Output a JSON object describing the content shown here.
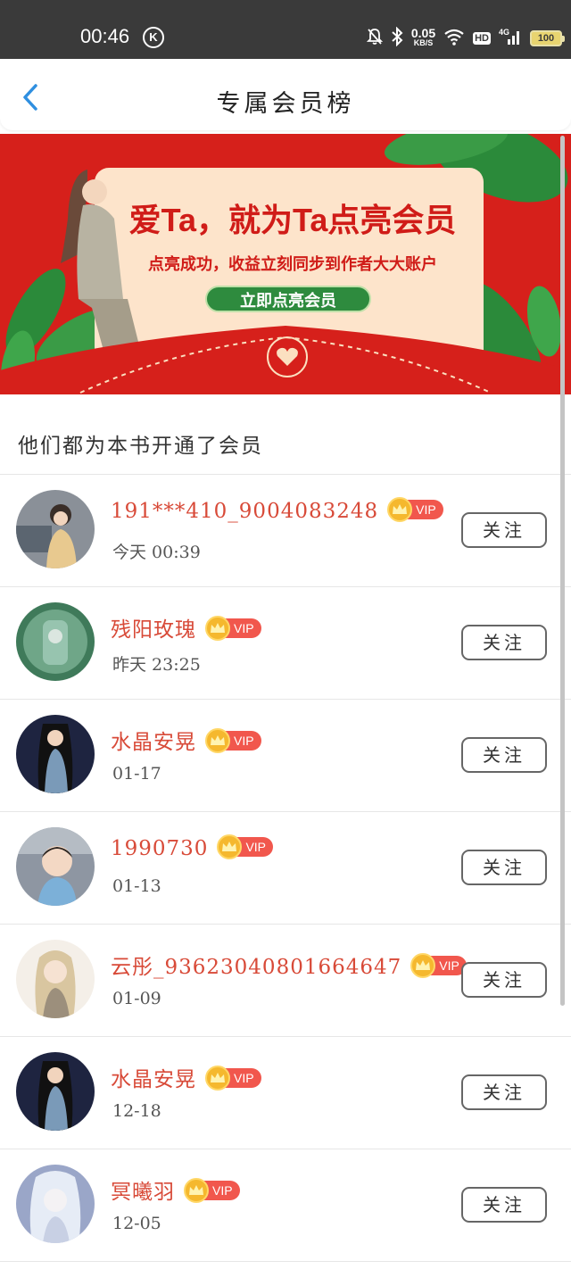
{
  "status_bar": {
    "time": "00:46",
    "k_badge": "K",
    "net_speed_value": "0.05",
    "net_speed_unit": "KB/S",
    "hd": "HD",
    "signal": "4G",
    "battery": "100"
  },
  "header": {
    "title": "专属会员榜",
    "back_icon": "chevron-left-icon"
  },
  "banner": {
    "headline": "爱Ta，就为Ta点亮会员",
    "subtitle": "点亮成功，收益立刻同步到作者大大账户",
    "button_label": "立即点亮会员",
    "bg_color": "#d6201b",
    "card_color": "#fde4cb",
    "button_color": "#2e8b3e"
  },
  "section_title": "他们都为本书开通了会员",
  "members": [
    {
      "name": "191***410_9004083248",
      "badge": "VIP",
      "time": "今天 00:39",
      "follow_label": "关注"
    },
    {
      "name": "残阳玫瑰",
      "badge": "VIP",
      "time": "昨天 23:25",
      "follow_label": "关注"
    },
    {
      "name": "水晶安晃",
      "badge": "VIP",
      "time": "01-17",
      "follow_label": "关注"
    },
    {
      "name": "1990730",
      "badge": "VIP",
      "time": "01-13",
      "follow_label": "关注"
    },
    {
      "name": "云彤_93623040801664647",
      "badge": "VIP",
      "time": "01-09",
      "follow_label": "关注"
    },
    {
      "name": "水晶安晃",
      "badge": "VIP",
      "time": "12-18",
      "follow_label": "关注"
    },
    {
      "name": "冥曦羽",
      "badge": "VIP",
      "time": "12-05",
      "follow_label": "关注"
    }
  ],
  "colors": {
    "name": "#d84a38",
    "vip_tag": "#f1574d",
    "crown": "#f5b82e",
    "back_icon": "#2f8fe0"
  }
}
